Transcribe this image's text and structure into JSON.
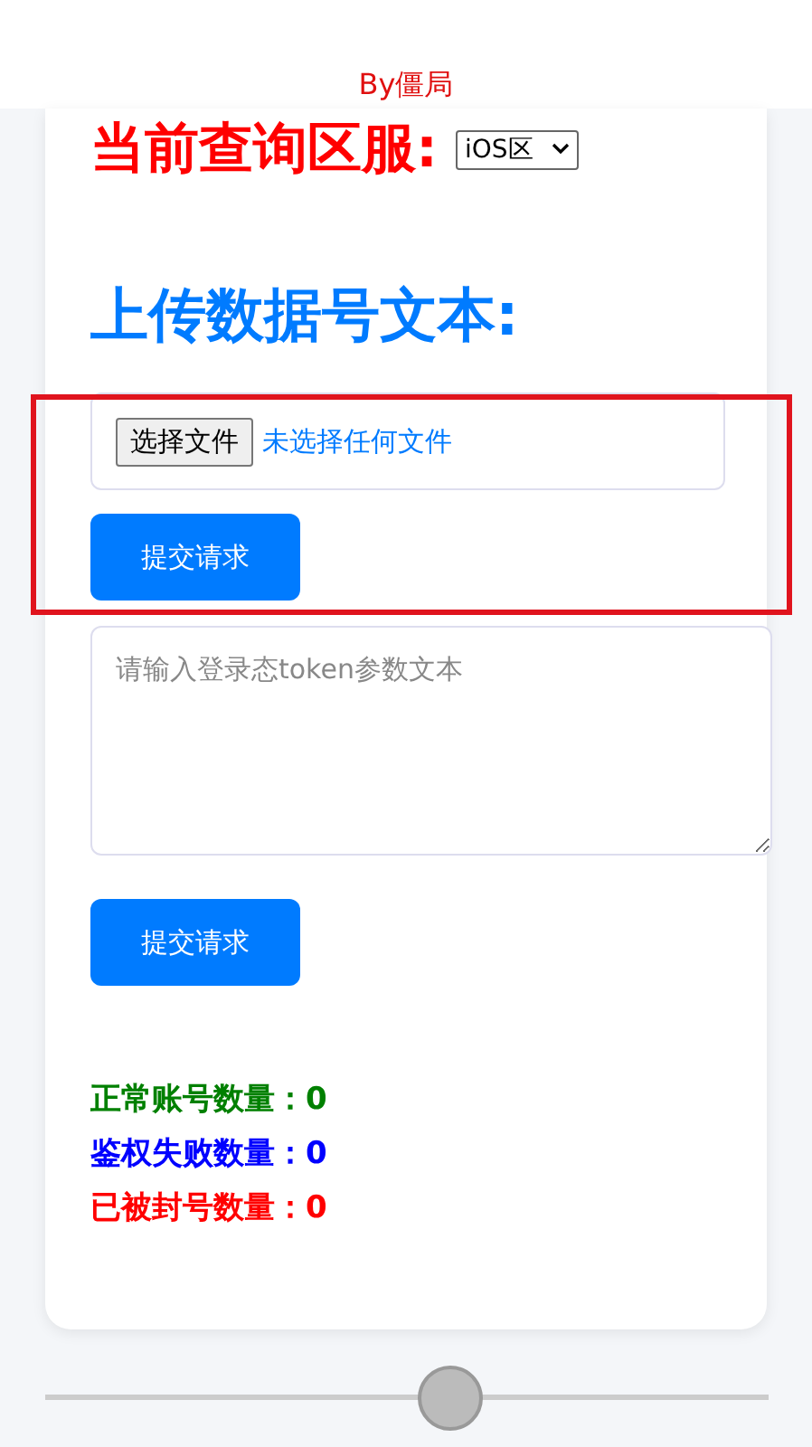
{
  "header": {
    "author": "By僵局"
  },
  "region": {
    "label": "当前查询区服:",
    "value": "iOS区"
  },
  "upload": {
    "title": "上传数据号文本:",
    "file_button": "选择文件",
    "file_status": "未选择任何文件",
    "submit": "提交请求",
    "highlighted": true
  },
  "token": {
    "placeholder": "请输入登录态token参数文本",
    "submit": "提交请求"
  },
  "stats": [
    {
      "label": "正常账号数量：",
      "value": "0",
      "color": "#008000"
    },
    {
      "label": "鉴权失败数量：",
      "value": "0",
      "color": "#0000ff"
    },
    {
      "label": "已被封号数量：",
      "value": "0",
      "color": "#ff0000"
    }
  ],
  "slider": {
    "level": 0.56
  }
}
